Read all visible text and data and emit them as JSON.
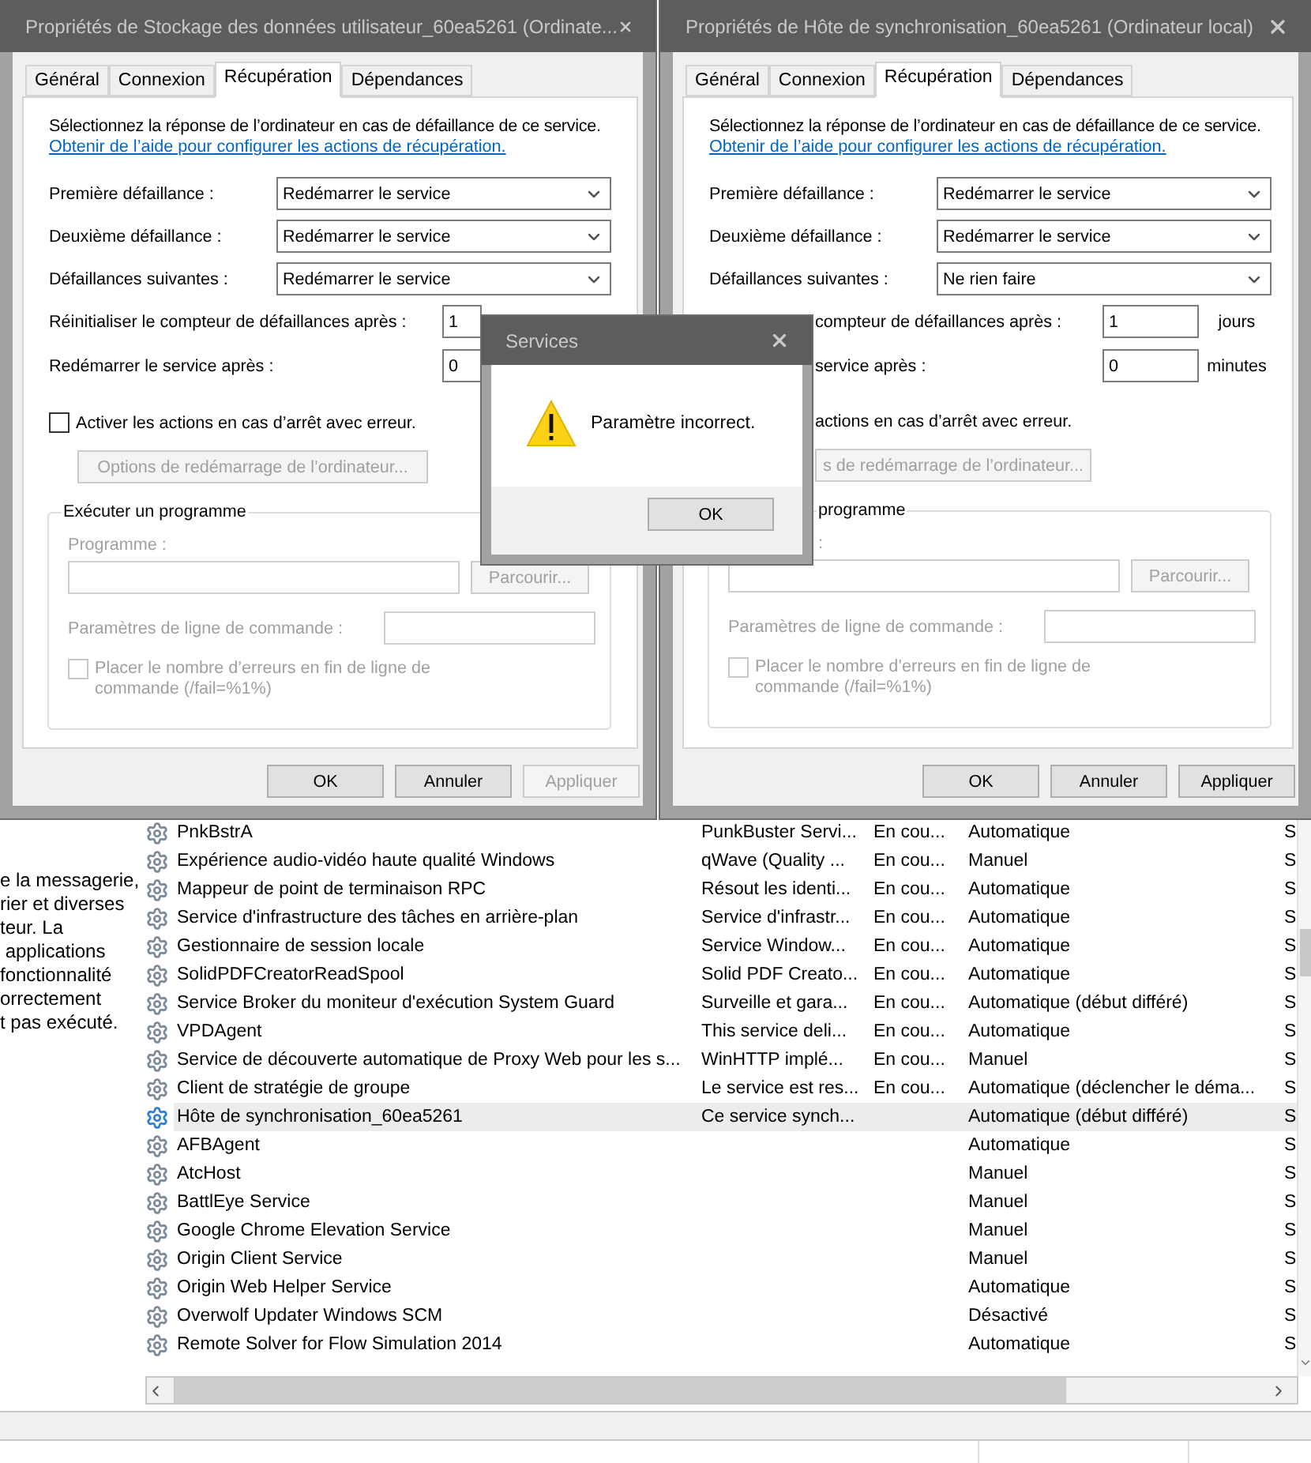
{
  "dialogs": [
    {
      "title": "Propriétés de Stockage des données utilisateur_60ea5261 (Ordinate...",
      "tabs": [
        {
          "label": "Général",
          "selected": false
        },
        {
          "label": "Connexion",
          "selected": false
        },
        {
          "label": "Récupération",
          "selected": true
        },
        {
          "label": "Dépendances",
          "selected": false
        }
      ],
      "intro": "Sélectionnez la réponse de l’ordinateur en cas de défaillance de ce service.",
      "help_link": "Obtenir de l’aide pour configurer les actions de récupération.",
      "failures": [
        {
          "label": "Première défaillance :",
          "value": "Redémarrer le service"
        },
        {
          "label": "Deuxième défaillance :",
          "value": "Redémarrer le service"
        },
        {
          "label": "Défaillances suivantes :",
          "value": "Redémarrer le service"
        }
      ],
      "reset": {
        "label": "Réinitialiser le compteur de défaillances après :",
        "value": "1"
      },
      "restart": {
        "label": "Redémarrer le service après :",
        "value": "0"
      },
      "stop_actions": {
        "label": "Activer les actions en cas d’arrêt avec erreur.",
        "checked": false
      },
      "restart_options_button": {
        "label": "Options de redémarrage de l’ordinateur...",
        "disabled": true
      },
      "run_program": {
        "legend": "Exécuter un programme",
        "disabled": true,
        "program_label": "Programme :",
        "browse_button": "Parcourir...",
        "params_label": "Paramètres de ligne de commande :",
        "append_fail_count": {
          "label_lines": [
            "Placer le nombre d’erreurs en fin de ligne de",
            "commande (/fail=%1%)"
          ],
          "checked": false
        }
      },
      "buttons": [
        {
          "label": "OK",
          "disabled": false
        },
        {
          "label": "Annuler",
          "disabled": false
        },
        {
          "label": "Appliquer",
          "disabled": true
        }
      ]
    },
    {
      "title": "Propriétés de Hôte de synchronisation_60ea5261 (Ordinateur local)",
      "tabs": [
        {
          "label": "Général",
          "selected": false
        },
        {
          "label": "Connexion",
          "selected": false
        },
        {
          "label": "Récupération",
          "selected": true
        },
        {
          "label": "Dépendances",
          "selected": false
        }
      ],
      "intro": "Sélectionnez la réponse de l’ordinateur en cas de défaillance de ce service.",
      "help_link": "Obtenir de l’aide pour configurer les actions de récupération.",
      "failures": [
        {
          "label": "Première défaillance :",
          "value": "Redémarrer le service"
        },
        {
          "label": "Deuxième défaillance :",
          "value": "Redémarrer le service"
        },
        {
          "label": "Défaillances suivantes :",
          "value": "Ne rien faire"
        }
      ],
      "reset": {
        "label": "compteur de défaillances après :",
        "value": "1",
        "unit": "jours"
      },
      "restart": {
        "label": "service après :",
        "value": "0",
        "unit": "minutes"
      },
      "stop_actions": {
        "label": "actions en cas d’arrêt avec erreur."
      },
      "restart_options_button": {
        "label": "s de redémarrage de l’ordinateur...",
        "disabled": true
      },
      "run_program": {
        "legend": "programme",
        "disabled": true,
        "program_label": ":",
        "browse_button": "Parcourir...",
        "params_label": "Paramètres de ligne de commande :",
        "append_fail_count": {
          "label_lines": [
            "Placer le nombre d’erreurs en fin de ligne de",
            "commande (/fail=%1%)"
          ],
          "checked": false
        }
      },
      "buttons": [
        {
          "label": "OK",
          "disabled": false
        },
        {
          "label": "Annuler",
          "disabled": false
        },
        {
          "label": "Appliquer",
          "disabled": false
        }
      ]
    }
  ],
  "message_box": {
    "title": "Services",
    "message": "Paramètre incorrect.",
    "button": "OK"
  },
  "services": {
    "description_lines": [
      "e la messagerie,",
      "rier et diverses",
      "teur. La",
      " applications",
      "fonctionnalité",
      "orrectement",
      "t pas exécuté."
    ],
    "rows": [
      {
        "name": "PnkBstrA",
        "description": "PunkBuster Servi...",
        "status": "En cou...",
        "startup_type": "Automatique",
        "column_5": "S",
        "selected": false
      },
      {
        "name": "Expérience audio-vidéo haute qualité Windows",
        "description": "qWave (Quality ...",
        "status": "En cou...",
        "startup_type": "Manuel",
        "column_5": "S",
        "selected": false
      },
      {
        "name": "Mappeur de point de terminaison RPC",
        "description": "Résout les identi...",
        "status": "En cou...",
        "startup_type": "Automatique",
        "column_5": "S",
        "selected": false
      },
      {
        "name": "Service d'infrastructure des tâches en arrière-plan",
        "description": "Service d'infrastr...",
        "status": "En cou...",
        "startup_type": "Automatique",
        "column_5": "S",
        "selected": false
      },
      {
        "name": "Gestionnaire de session locale",
        "description": "Service Window...",
        "status": "En cou...",
        "startup_type": "Automatique",
        "column_5": "S",
        "selected": false
      },
      {
        "name": "SolidPDFCreatorReadSpool",
        "description": "Solid PDF Creato...",
        "status": "En cou...",
        "startup_type": "Automatique",
        "column_5": "S",
        "selected": false
      },
      {
        "name": "Service Broker du moniteur d'exécution System Guard",
        "description": "Surveille et gara...",
        "status": "En cou...",
        "startup_type": "Automatique (début différé)",
        "column_5": "S",
        "selected": false
      },
      {
        "name": "VPDAgent",
        "description": "This service deli...",
        "status": "En cou...",
        "startup_type": "Automatique",
        "column_5": "S",
        "selected": false
      },
      {
        "name": "Service de découverte automatique de Proxy Web pour les s...",
        "description": "WinHTTP implé...",
        "status": "En cou...",
        "startup_type": "Manuel",
        "column_5": "S",
        "selected": false
      },
      {
        "name": "Client de stratégie de groupe",
        "description": "Le service est res...",
        "status": "En cou...",
        "startup_type": "Automatique (déclencher le déma...",
        "column_5": "S",
        "selected": false
      },
      {
        "name": "Hôte de synchronisation_60ea5261",
        "description": "Ce service synch...",
        "startup_type": "Automatique (début différé)",
        "column_5": "S",
        "selected": true
      },
      {
        "name": "AFBAgent",
        "startup_type": "Automatique",
        "column_5": "S",
        "selected": false
      },
      {
        "name": "AtcHost",
        "startup_type": "Manuel",
        "column_5": "S",
        "selected": false
      },
      {
        "name": "BattlEye Service",
        "startup_type": "Manuel",
        "column_5": "S",
        "selected": false
      },
      {
        "name": "Google Chrome Elevation Service",
        "startup_type": "Manuel",
        "column_5": "S",
        "selected": false
      },
      {
        "name": "Origin Client Service",
        "startup_type": "Manuel",
        "column_5": "S",
        "selected": false
      },
      {
        "name": "Origin Web Helper Service",
        "startup_type": "Automatique",
        "column_5": "S",
        "selected": false
      },
      {
        "name": "Overwolf Updater Windows SCM",
        "startup_type": "Désactivé",
        "column_5": "S",
        "selected": false
      },
      {
        "name": "Remote Solver for Flow Simulation 2014",
        "startup_type": "Automatique",
        "column_5": "S",
        "selected": false
      }
    ]
  }
}
